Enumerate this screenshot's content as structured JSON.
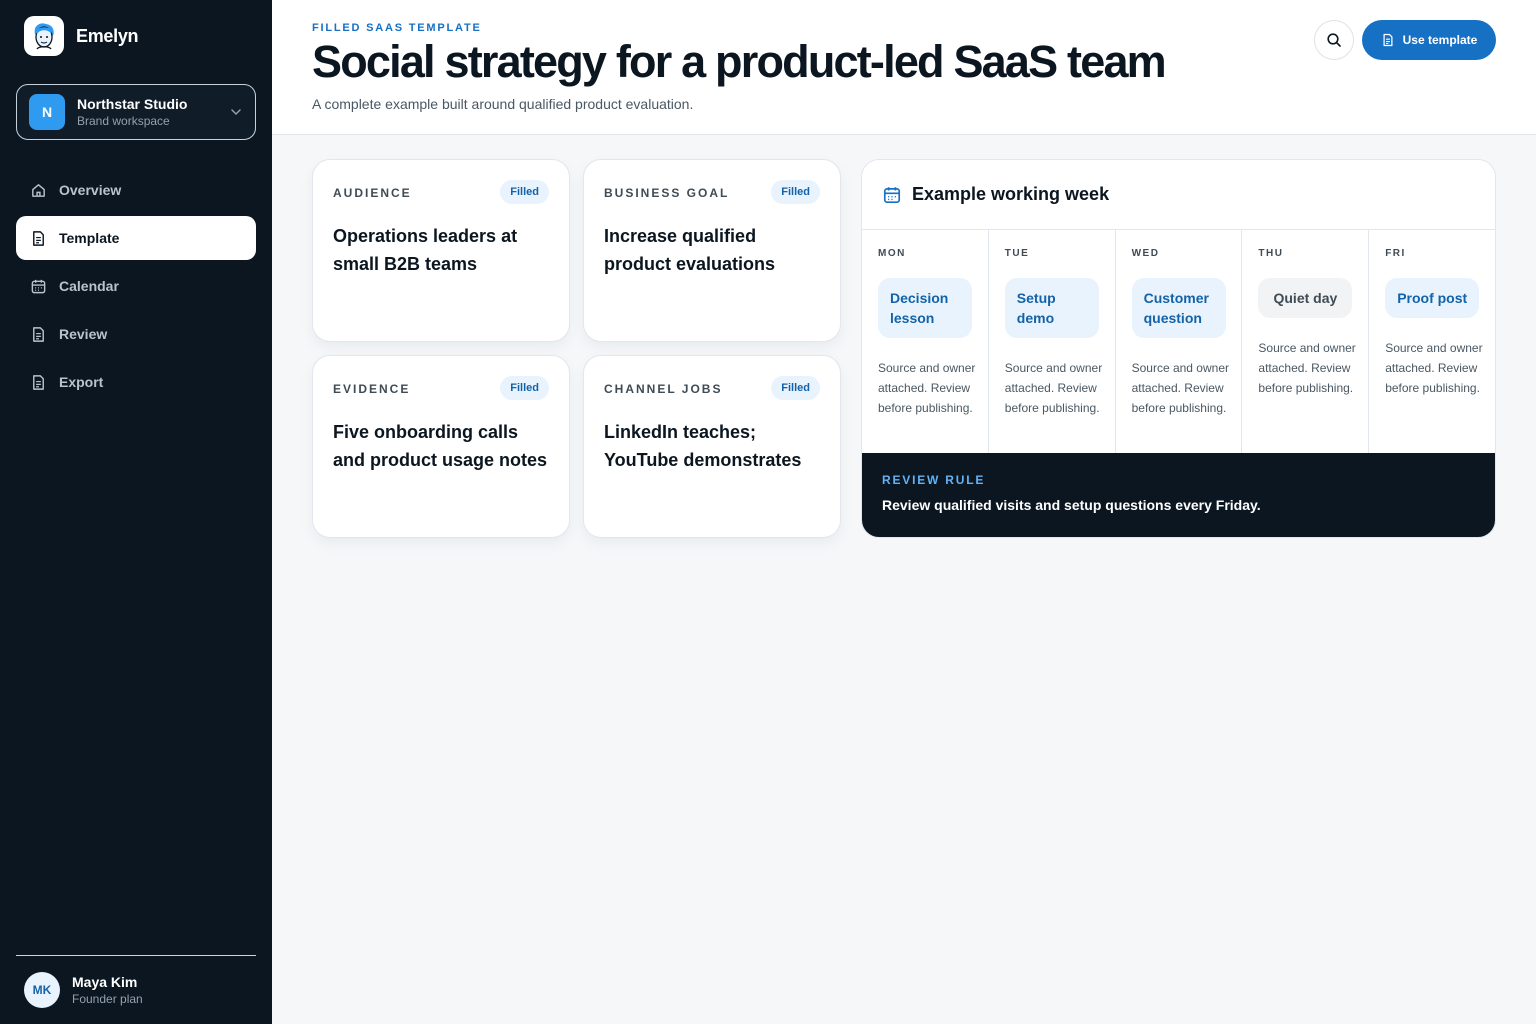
{
  "brand": {
    "name": "Emelyn"
  },
  "workspace": {
    "initial": "N",
    "name": "Northstar Studio",
    "subtitle": "Brand workspace"
  },
  "nav": [
    {
      "label": "Overview",
      "icon": "home-icon",
      "active": false
    },
    {
      "label": "Template",
      "icon": "document-icon",
      "active": true
    },
    {
      "label": "Calendar",
      "icon": "calendar-icon",
      "active": false
    },
    {
      "label": "Review",
      "icon": "document-icon",
      "active": false
    },
    {
      "label": "Export",
      "icon": "document-icon",
      "active": false
    }
  ],
  "user": {
    "initials": "MK",
    "name": "Maya Kim",
    "plan": "Founder plan"
  },
  "header": {
    "eyebrow": "FILLED SAAS TEMPLATE",
    "title": "Social strategy for a product-led SaaS team",
    "subtitle": "A complete example built around qualified product evaluation.",
    "use_template_label": "Use template"
  },
  "cards": [
    {
      "label": "AUDIENCE",
      "badge": "Filled",
      "value": "Operations leaders at small B2B teams"
    },
    {
      "label": "BUSINESS GOAL",
      "badge": "Filled",
      "value": "Increase qualified product evaluations"
    },
    {
      "label": "EVIDENCE",
      "badge": "Filled",
      "value": "Five onboarding calls and product usage notes"
    },
    {
      "label": "CHANNEL JOBS",
      "badge": "Filled",
      "value": "LinkedIn teaches; YouTube demonstrates"
    }
  ],
  "week": {
    "title": "Example working week",
    "days": [
      {
        "label": "MON",
        "chip": "Decision lesson",
        "note": "Source and owner attached. Review before publishing."
      },
      {
        "label": "TUE",
        "chip": "Setup demo",
        "note": "Source and owner attached. Review before publishing."
      },
      {
        "label": "WED",
        "chip": "Customer question",
        "note": "Source and owner attached. Review before publishing."
      },
      {
        "label": "THU",
        "chip": "Quiet day",
        "note": "Source and owner attached. Review before publishing."
      },
      {
        "label": "FRI",
        "chip": "Proof post",
        "note": "Source and owner attached. Review before publishing."
      }
    ],
    "rule_label": "REVIEW RULE",
    "rule_text": "Review qualified visits and setup questions every Friday."
  },
  "colors": {
    "sidebar": "#0b1620",
    "accent": "#1670c4",
    "badge_bg": "#e8f3fd"
  }
}
